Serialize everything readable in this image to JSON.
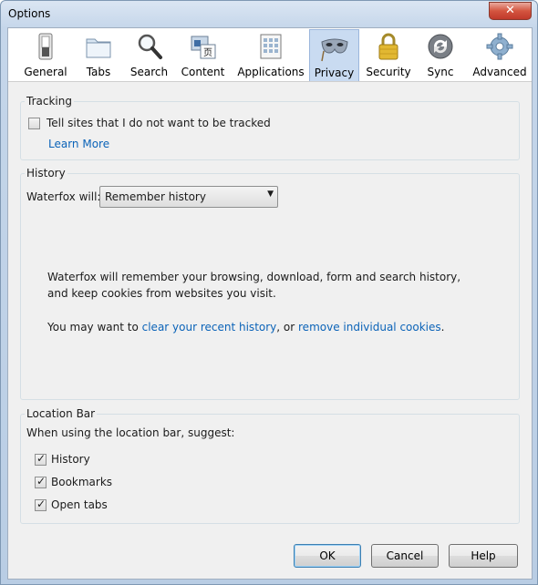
{
  "window": {
    "title": "Options",
    "close_glyph": "✕"
  },
  "tabs": [
    {
      "label": "General",
      "icon": "switch-icon"
    },
    {
      "label": "Tabs",
      "icon": "folder-tabs-icon"
    },
    {
      "label": "Search",
      "icon": "magnifier-icon"
    },
    {
      "label": "Content",
      "icon": "content-icon"
    },
    {
      "label": "Applications",
      "icon": "applications-icon"
    },
    {
      "label": "Privacy",
      "icon": "mask-icon",
      "selected": true
    },
    {
      "label": "Security",
      "icon": "padlock-icon"
    },
    {
      "label": "Sync",
      "icon": "sync-icon"
    },
    {
      "label": "Advanced",
      "icon": "gear-icon"
    }
  ],
  "tracking": {
    "title": "Tracking",
    "dnt_label": "Tell sites that I do not want to be tracked",
    "dnt_checked": false,
    "learn_more": "Learn More"
  },
  "history": {
    "title": "History",
    "will_label": "Waterfox will:",
    "mode": "Remember history",
    "description": "Waterfox will remember your browsing, download, form and search history, and keep cookies from websites you visit.",
    "you_may_want": "You may want to",
    "clear_link": "clear your recent history",
    "or_text": ", or",
    "remove_link": "remove individual cookies",
    "period": "."
  },
  "location_bar": {
    "title": "Location Bar",
    "subtitle": "When using the location bar, suggest:",
    "options": [
      {
        "label": "History",
        "checked": true
      },
      {
        "label": "Bookmarks",
        "checked": true
      },
      {
        "label": "Open tabs",
        "checked": true
      }
    ]
  },
  "buttons": {
    "ok": "OK",
    "cancel": "Cancel",
    "help": "Help"
  },
  "colors": {
    "link": "#0b63b8",
    "selected_tab": "#c9dbf1"
  }
}
